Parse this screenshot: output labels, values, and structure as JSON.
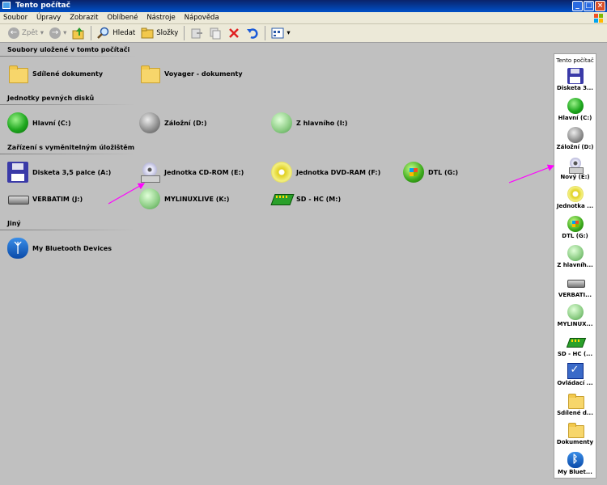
{
  "window": {
    "title": "Tento počítač"
  },
  "menu": [
    "Soubor",
    "Úpravy",
    "Zobrazit",
    "Oblíbené",
    "Nástroje",
    "Nápověda"
  ],
  "toolbar": {
    "back": "Zpět",
    "search": "Hledat",
    "folders": "Složky"
  },
  "groups": {
    "stored": "Soubory uložené v tomto počítači",
    "hdd": "Jednotky pevných disků",
    "removable": "Zařízení s vyměnitelným úložištěm",
    "other": "Jiný"
  },
  "items": {
    "shared_docs": "Sdílené dokumenty",
    "voyager_docs": "Voyager - dokumenty",
    "hlavni": "Hlavní (C:)",
    "zalozni": "Záložní (D:)",
    "z_hlavniho": "Z hlavního (I:)",
    "floppy": "Disketa 3,5 palce (A:)",
    "cdrom": "Jednotka CD-ROM (E:)",
    "dvdram": "Jednotka DVD-RAM (F:)",
    "dtl": "DTL (G:)",
    "verbatim": "VERBATIM (J:)",
    "mylinuxlive": "MYLINUXLIVE (K:)",
    "sdhc": "SD - HC (M:)",
    "bluetooth": "My Bluetooth Devices"
  },
  "panel": {
    "title": "Tento počítač",
    "items": [
      {
        "label": "Disketa 3...",
        "icon": "floppy-icon"
      },
      {
        "label": "Hlavní (C:)",
        "icon": "green-disk-icon"
      },
      {
        "label": "Záložní (D:)",
        "icon": "gray-disk-icon"
      },
      {
        "label": "Nový (E:)",
        "icon": "cdrom-icon"
      },
      {
        "label": "Jednotka ...",
        "icon": "dvd-icon"
      },
      {
        "label": "DTL (G:)",
        "icon": "xp-disk-icon"
      },
      {
        "label": "Z hlavníh...",
        "icon": "light-green-disk-icon"
      },
      {
        "label": "VERBATI...",
        "icon": "usb-drive-icon"
      },
      {
        "label": "MYLINUX...",
        "icon": "light-green-disk-icon"
      },
      {
        "label": "SD - HC (...",
        "icon": "sd-card-icon"
      },
      {
        "label": "Ovládací ...",
        "icon": "control-panel-icon"
      },
      {
        "label": "Sdílené d...",
        "icon": "folder-icon"
      },
      {
        "label": "Dokumenty",
        "icon": "folder-icon"
      },
      {
        "label": "My Bluet...",
        "icon": "bluetooth-icon"
      }
    ]
  },
  "colors": {
    "titlebar": "#0a246a",
    "background": "#c0c0c0",
    "arrow": "#ff00ff"
  }
}
